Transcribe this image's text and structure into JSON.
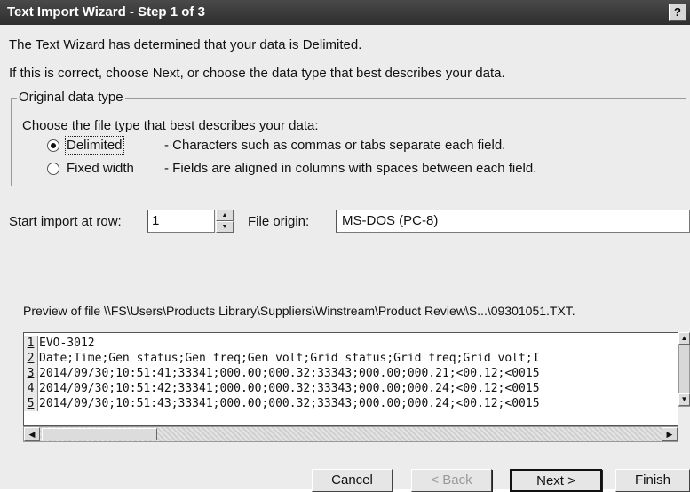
{
  "window": {
    "title": "Text Import Wizard - Step 1 of 3",
    "help_label": "?"
  },
  "intro": {
    "line1": "The Text Wizard has determined that your data is Delimited.",
    "line2": "If this is correct, choose Next, or choose the data type that best describes your data."
  },
  "original_data_type": {
    "legend": "Original data type",
    "prompt": "Choose the file type that best describes your data:",
    "options": [
      {
        "label": "Delimited",
        "description": "- Characters such as commas or tabs separate each field.",
        "checked": true
      },
      {
        "label": "Fixed width",
        "description": "- Fields are aligned in columns with spaces between each field.",
        "checked": false
      }
    ]
  },
  "start_row": {
    "label": "Start import at row:",
    "value": "1"
  },
  "file_origin": {
    "label": "File origin:",
    "value": "MS-DOS (PC-8)"
  },
  "preview": {
    "label": "Preview of file \\\\FS\\Users\\Products Library\\Suppliers\\Winstream\\Product Review\\S...\\09301051.TXT.",
    "lines": [
      {
        "n": "1",
        "text": "EVO-3012"
      },
      {
        "n": "2",
        "text": "Date;Time;Gen status;Gen freq;Gen volt;Grid status;Grid freq;Grid volt;I"
      },
      {
        "n": "3",
        "text": "2014/09/30;10:51:41;33341;000.00;000.32;33343;000.00;000.21;<00.12;<0015"
      },
      {
        "n": "4",
        "text": "2014/09/30;10:51:42;33341;000.00;000.32;33343;000.00;000.24;<00.12;<0015"
      },
      {
        "n": "5",
        "text": "2014/09/30;10:51:43;33341;000.00;000.32;33343;000.00;000.24;<00.12;<0015"
      }
    ]
  },
  "buttons": {
    "cancel": "Cancel",
    "back": "< Back",
    "next": "Next >",
    "finish": "Finish"
  },
  "icons": {
    "spin_up": "▲",
    "spin_down": "▼",
    "scroll_up": "▲",
    "scroll_down": "▼",
    "scroll_left": "◀",
    "scroll_right": "▶"
  }
}
